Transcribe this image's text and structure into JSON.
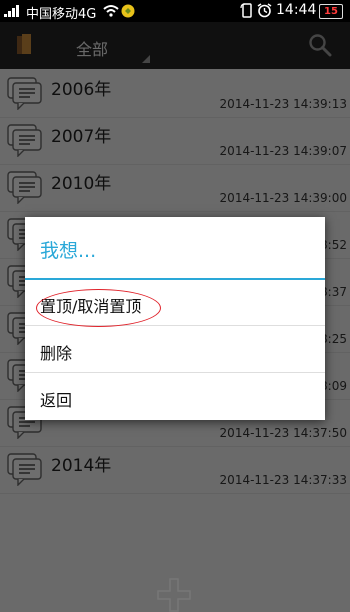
{
  "status_bar": {
    "carrier": "中国移动4G",
    "time": "14:44",
    "battery": "15"
  },
  "app_bar": {
    "filter_label": "全部"
  },
  "list": {
    "items": [
      {
        "title": "2006年",
        "timestamp": "2014-11-23 14:39:13"
      },
      {
        "title": "2007年",
        "timestamp": "2014-11-23 14:39:07"
      },
      {
        "title": "2010年",
        "timestamp": "2014-11-23 14:39:00"
      },
      {
        "title": "",
        "timestamp": "8:52"
      },
      {
        "title": "",
        "timestamp": "8:37"
      },
      {
        "title": "",
        "timestamp": "8:25"
      },
      {
        "title": "",
        "timestamp": "8:09"
      },
      {
        "title": "",
        "timestamp": "2014-11-23 14:37:50"
      },
      {
        "title": "2014年",
        "timestamp": "2014-11-23 14:37:33"
      }
    ]
  },
  "dialog": {
    "title": "我想...",
    "options": [
      {
        "label": "置顶/取消置顶"
      },
      {
        "label": "删除"
      },
      {
        "label": "返回"
      }
    ]
  },
  "colors": {
    "accent": "#2aa8d8",
    "annotation": "#e0232b"
  }
}
